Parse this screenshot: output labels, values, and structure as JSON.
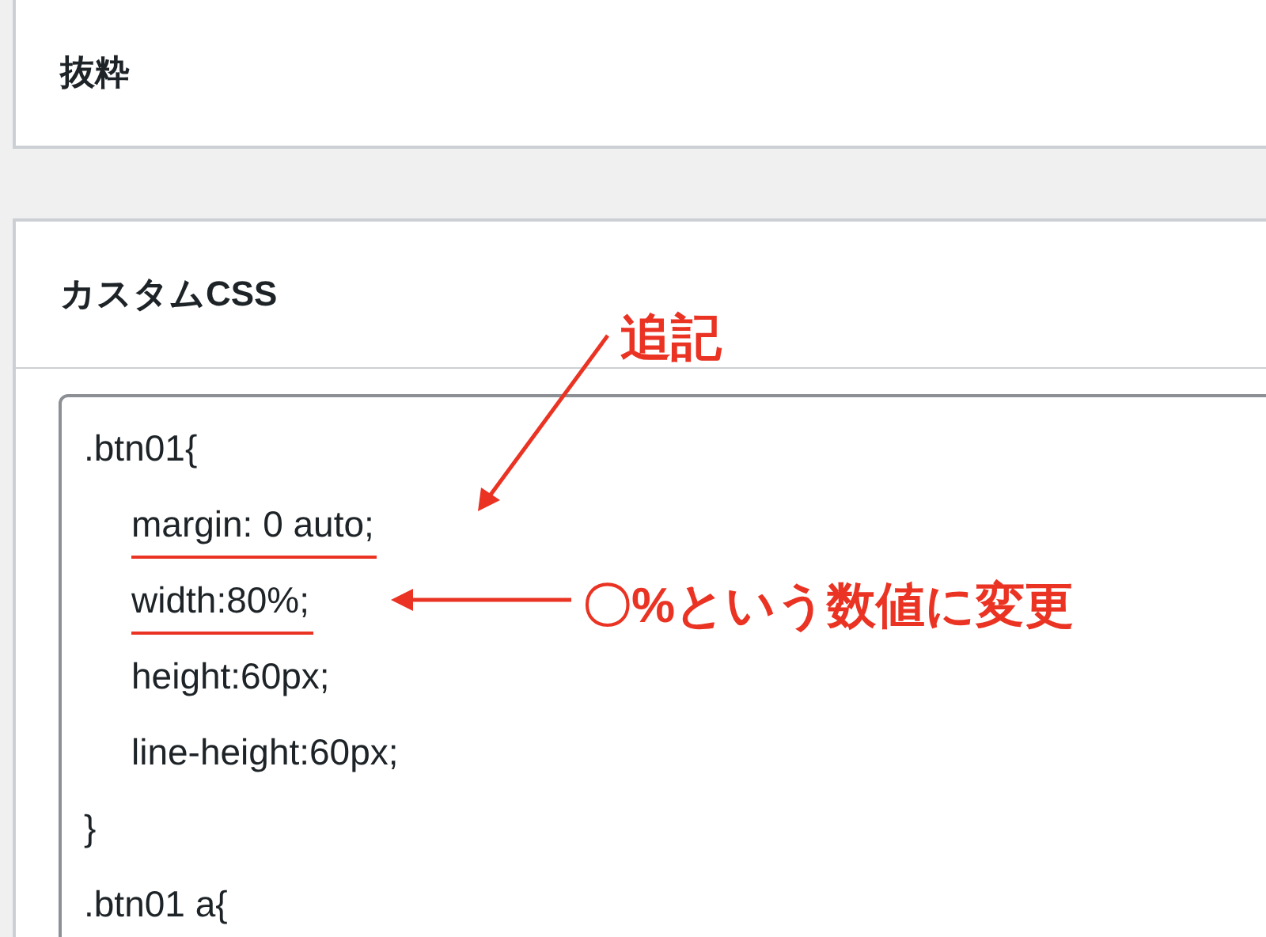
{
  "excerpt_panel": {
    "title": "抜粋"
  },
  "custom_css_panel": {
    "title": "カスタムCSS",
    "code_lines": [
      {
        "text": ".btn01{",
        "indented": false,
        "underlined": false
      },
      {
        "text": "margin: 0 auto;",
        "indented": true,
        "underlined": true
      },
      {
        "text": "width:80%;",
        "indented": true,
        "underlined": true
      },
      {
        "text": "height:60px;",
        "indented": true,
        "underlined": false
      },
      {
        "text": "line-height:60px;",
        "indented": true,
        "underlined": false
      },
      {
        "text": "}",
        "indented": false,
        "underlined": false
      },
      {
        "text": ".btn01 a{",
        "indented": false,
        "underlined": false
      }
    ]
  },
  "annotations": [
    {
      "kind": "arrow",
      "text": "追記"
    },
    {
      "kind": "arrow",
      "text": "〇%という数値に変更"
    }
  ]
}
